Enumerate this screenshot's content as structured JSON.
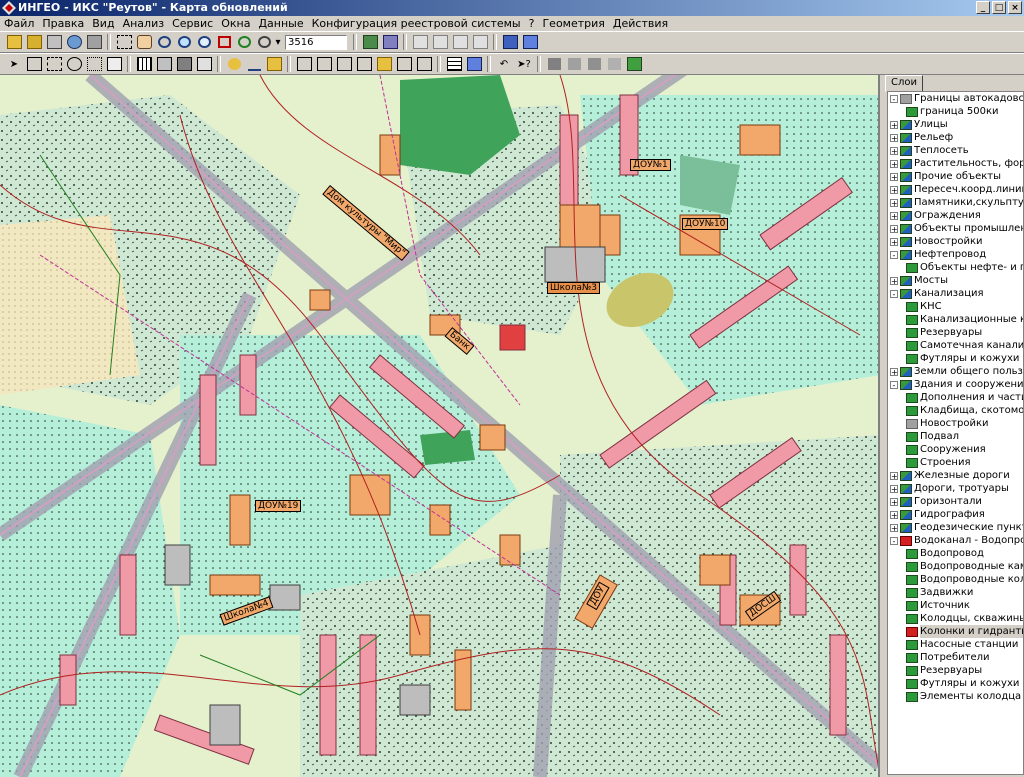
{
  "window": {
    "title": "ИНГЕО - ИКС \"Реутов\" - Карта обновлений",
    "buttons": [
      "_",
      "□",
      "×"
    ]
  },
  "menu": [
    "Файл",
    "Правка",
    "Вид",
    "Анализ",
    "Сервис",
    "Окна",
    "Данные",
    "Конфигурация реестровой системы",
    "?",
    "Геометрия",
    "Действия"
  ],
  "toolbar": {
    "scale_value": "3516"
  },
  "map": {
    "labels": [
      {
        "text": "Дом культуры \"Мир\""
      },
      {
        "text": "Школа№3"
      },
      {
        "text": "ДОУ№10"
      },
      {
        "text": "ДОУ№19"
      },
      {
        "text": "ДОУ№1"
      },
      {
        "text": "ДОСШ"
      },
      {
        "text": "ДОУ"
      },
      {
        "text": "Школа№4"
      },
      {
        "text": "Банк"
      }
    ]
  },
  "layers_panel": {
    "tab_label": "Слои",
    "items": [
      {
        "label": "Границы автокадовски",
        "level": 0,
        "expander": "-",
        "icon": "gray"
      },
      {
        "label": "граница 500ки",
        "level": 1,
        "expander": "",
        "icon": "sub"
      },
      {
        "label": "Улицы",
        "level": 0,
        "expander": "+",
        "icon": "layer"
      },
      {
        "label": "Рельеф",
        "level": 0,
        "expander": "+",
        "icon": "layer"
      },
      {
        "label": "Теплосеть",
        "level": 0,
        "expander": "+",
        "icon": "layer"
      },
      {
        "label": "Растительность, формь",
        "level": 0,
        "expander": "+",
        "icon": "layer"
      },
      {
        "label": "Прочие объекты",
        "level": 0,
        "expander": "+",
        "icon": "layer"
      },
      {
        "label": "Пересеч.коорд.линий",
        "level": 0,
        "expander": "+",
        "icon": "layer"
      },
      {
        "label": "Памятники,скульптуры,",
        "level": 0,
        "expander": "+",
        "icon": "layer"
      },
      {
        "label": "Ограждения",
        "level": 0,
        "expander": "+",
        "icon": "layer"
      },
      {
        "label": "Объекты промышленно",
        "level": 0,
        "expander": "+",
        "icon": "layer"
      },
      {
        "label": "Новостройки",
        "level": 0,
        "expander": "+",
        "icon": "layer"
      },
      {
        "label": "Нефтепровод",
        "level": 0,
        "expander": "-",
        "icon": "layer"
      },
      {
        "label": "Объекты нефте- и га",
        "level": 1,
        "expander": "",
        "icon": "sub"
      },
      {
        "label": "Мосты",
        "level": 0,
        "expander": "+",
        "icon": "layer"
      },
      {
        "label": "Канализация",
        "level": 0,
        "expander": "-",
        "icon": "layer"
      },
      {
        "label": "КНС",
        "level": 1,
        "expander": "",
        "icon": "sub"
      },
      {
        "label": "Канализационные к",
        "level": 1,
        "expander": "",
        "icon": "sub"
      },
      {
        "label": "Резервуары",
        "level": 1,
        "expander": "",
        "icon": "sub"
      },
      {
        "label": "Самотечная канали:",
        "level": 1,
        "expander": "",
        "icon": "sub"
      },
      {
        "label": "Футляры и кожухи",
        "level": 1,
        "expander": "",
        "icon": "sub"
      },
      {
        "label": "Земли общего пользова",
        "level": 0,
        "expander": "+",
        "icon": "layer"
      },
      {
        "label": "Здания и сооружения",
        "level": 0,
        "expander": "-",
        "icon": "layer"
      },
      {
        "label": "Дополнения и части",
        "level": 1,
        "expander": "",
        "icon": "sub"
      },
      {
        "label": "Кладбища, скотомо",
        "level": 1,
        "expander": "",
        "icon": "sub"
      },
      {
        "label": "Новостройки",
        "level": 1,
        "expander": "",
        "icon": "gray"
      },
      {
        "label": "Подвал",
        "level": 1,
        "expander": "",
        "icon": "sub"
      },
      {
        "label": "Сооружения",
        "level": 1,
        "expander": "",
        "icon": "sub"
      },
      {
        "label": "Строения",
        "level": 1,
        "expander": "",
        "icon": "sub"
      },
      {
        "label": "Железные дороги",
        "level": 0,
        "expander": "+",
        "icon": "layer"
      },
      {
        "label": "Дороги, тротуары",
        "level": 0,
        "expander": "+",
        "icon": "layer"
      },
      {
        "label": "Горизонтали",
        "level": 0,
        "expander": "+",
        "icon": "layer"
      },
      {
        "label": "Гидрография",
        "level": 0,
        "expander": "+",
        "icon": "layer"
      },
      {
        "label": "Геодезические пункты",
        "level": 0,
        "expander": "+",
        "icon": "layer"
      },
      {
        "label": "Водоканал - Водопровод",
        "level": 0,
        "expander": "-",
        "icon": "red"
      },
      {
        "label": "Водопровод",
        "level": 1,
        "expander": "",
        "icon": "sub"
      },
      {
        "label": "Водопроводные кам",
        "level": 1,
        "expander": "",
        "icon": "sub"
      },
      {
        "label": "Водопроводные кол",
        "level": 1,
        "expander": "",
        "icon": "sub"
      },
      {
        "label": "Задвижки",
        "level": 1,
        "expander": "",
        "icon": "sub"
      },
      {
        "label": "Источник",
        "level": 1,
        "expander": "",
        "icon": "sub"
      },
      {
        "label": "Колодцы, скважины",
        "level": 1,
        "expander": "",
        "icon": "sub"
      },
      {
        "label": "Колонки и гидранты",
        "level": 1,
        "expander": "",
        "icon": "red",
        "selected": true
      },
      {
        "label": "Насосные станции",
        "level": 1,
        "expander": "",
        "icon": "sub"
      },
      {
        "label": "Потребители",
        "level": 1,
        "expander": "",
        "icon": "sub"
      },
      {
        "label": "Резервуары",
        "level": 1,
        "expander": "",
        "icon": "sub"
      },
      {
        "label": "Футляры и кожухи",
        "level": 1,
        "expander": "",
        "icon": "sub"
      },
      {
        "label": "Элементы колодца",
        "level": 1,
        "expander": "",
        "icon": "sub"
      }
    ]
  }
}
